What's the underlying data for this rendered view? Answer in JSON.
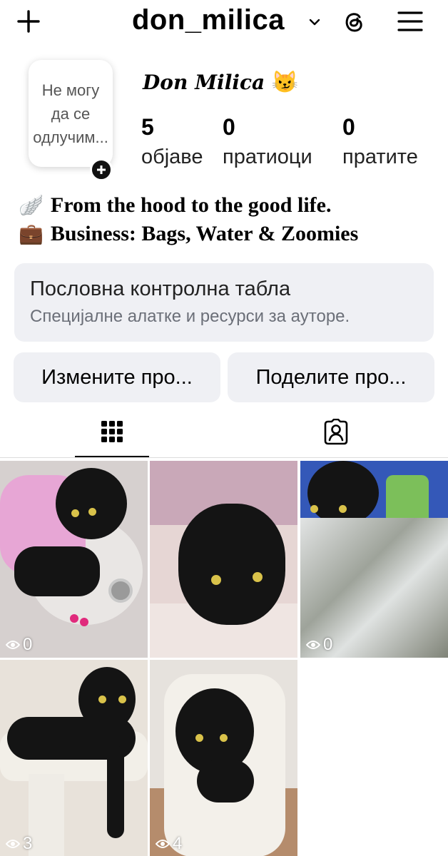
{
  "header": {
    "username": "don_milica"
  },
  "profile": {
    "note_text": "Не могу да се одлучим...",
    "display_name": "Don Milica",
    "display_emoji": "😼",
    "stats": [
      {
        "value": "5",
        "label": "објаве"
      },
      {
        "value": "0",
        "label": "пратиоци"
      },
      {
        "value": "0",
        "label": "пратите"
      }
    ],
    "bio": [
      {
        "emoji": "🪽",
        "text": "From the hood to the good life."
      },
      {
        "emoji": "💼",
        "text": "Business: Bags, Water & Zoomies"
      }
    ]
  },
  "dashboard": {
    "title": "Пословна контролна табла",
    "subtitle": "Специјалне алатке и ресурси за ауторе."
  },
  "buttons": {
    "edit": "Измените про...",
    "share": "Поделите про..."
  },
  "posts": [
    {
      "views": "0",
      "bg": "#d9d2d0"
    },
    {
      "views": "",
      "bg": "#e8d7d6"
    },
    {
      "views": "0",
      "bg": "#b9c2c3"
    },
    {
      "views": "3",
      "bg": "#e7e2da"
    },
    {
      "views": "4",
      "bg": "#e8e4df"
    }
  ],
  "icons": {
    "add": "plus-icon",
    "dropdown": "chevron-down-icon",
    "threads": "threads-icon",
    "menu": "hamburger-menu-icon",
    "grid": "grid-icon",
    "tagged": "tagged-person-icon",
    "views": "eye-icon"
  }
}
